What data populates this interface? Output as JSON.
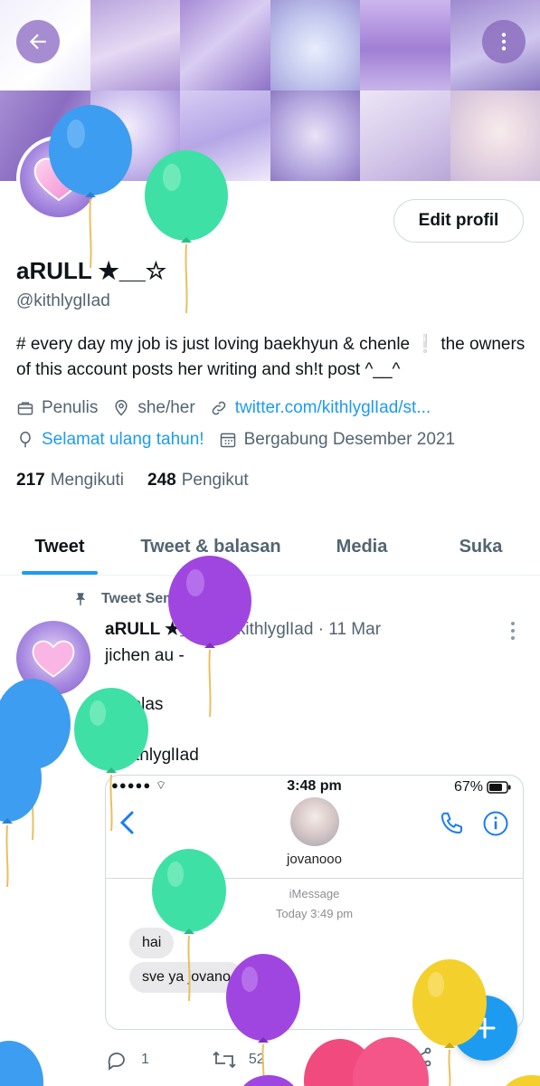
{
  "profile": {
    "name": "aRULL ★__☆",
    "handle": "@kithlyglIad",
    "bio": "# every day my job is just loving baekhyun & chenle ❕ the owners of this account posts her writing and sh!t post ^__^",
    "edit_label": "Edit profil",
    "occupation": "Penulis",
    "pronouns": "she/her",
    "website": "twitter.com/kithlyglIad/st...",
    "birthday": "Selamat ulang tahun!",
    "joined": "Bergabung Desember 2021",
    "following_count": "217",
    "following_label": "Mengikuti",
    "followers_count": "248",
    "followers_label": "Pengikut"
  },
  "tabs": [
    {
      "label": "Tweet",
      "active": true
    },
    {
      "label": "Tweet & balasan",
      "active": false
    },
    {
      "label": "Media",
      "active": false
    },
    {
      "label": "Suka",
      "active": false
    }
  ],
  "tweet": {
    "pinned_label": "Tweet Sematan",
    "author": "aRULL ★__☆",
    "handle": "@kithlyglIad",
    "date": "· 11 Mar",
    "line1": "jichen au -",
    "line2": "sekelas",
    "line3": "© kithlyglIad",
    "replies": "1",
    "retweets": "52"
  },
  "embedded": {
    "time": "3:48 pm",
    "battery": "67%",
    "contact": "jovanooo",
    "service": "iMessage",
    "timestamp": "Today 3:49 pm",
    "msg1": "hai",
    "msg2": "sve ya jovano"
  },
  "colors": {
    "accent": "#1d9bf0",
    "balloon_blue": "#3d9df0",
    "balloon_green": "#3fe0a6",
    "balloon_purple": "#a046e0",
    "balloon_yellow": "#f3d02c",
    "balloon_pink": "#f04a7e"
  }
}
